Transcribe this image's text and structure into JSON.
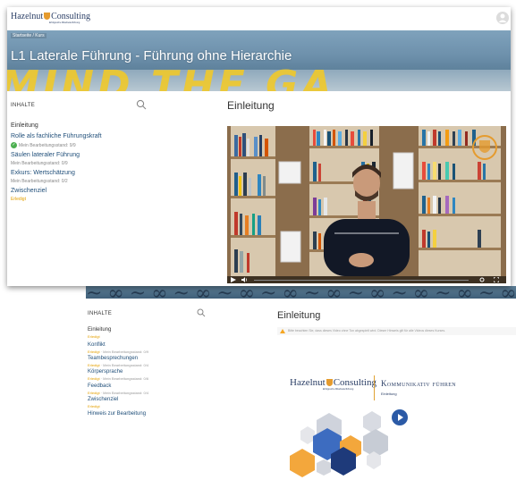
{
  "front": {
    "logo": {
      "brand_left": "Hazelnut",
      "brand_right": "Consulting",
      "tagline": "Erfolgreiche Mitarbeiterführung"
    },
    "breadcrumb": "Startseite / Kurs",
    "course_title": "L1 Laterale Führung - Führung ohne Hierarchie",
    "banner_text": "MIND THE GA",
    "sidebar": {
      "header": "INHALTE",
      "items": [
        {
          "label": "Einleitung",
          "sub": ""
        },
        {
          "label": "Rolle als fachliche Führungskraft",
          "sub": "Mein Bearbeitungsstand: 9/9",
          "done": true
        },
        {
          "label": "Säulen lateraler Führung",
          "sub": "Mein Bearbeitungsstand: 0/9"
        },
        {
          "label": "Exkurs: Wertschätzung",
          "sub": "Mein Bearbeitungsstand: 0/2"
        },
        {
          "label": "Zwischenziel",
          "sub": "Erledigt"
        }
      ]
    },
    "main_title": "Einleitung",
    "video": {
      "player": "video-player"
    }
  },
  "back": {
    "sidebar": {
      "header": "INHALTE",
      "items": [
        {
          "label": "Einleitung",
          "sub_status": "Erledigt",
          "sub": ""
        },
        {
          "label": "Konflikt",
          "sub_status": "Erledigt",
          "sub": "Mein Bearbeitungsstand: 0/9"
        },
        {
          "label": "Teambesprechungen",
          "sub_status": "Erledigt",
          "sub": "Mein Bearbeitungsstand: 0/4"
        },
        {
          "label": "Körpersprache",
          "sub_status": "Erledigt",
          "sub": "Mein Bearbeitungsstand: 0/6"
        },
        {
          "label": "Feedback",
          "sub_status": "Erledigt",
          "sub": "Mein Bearbeitungsstand: 0/4"
        },
        {
          "label": "Zwischenziel",
          "sub_status": "Erledigt",
          "sub": ""
        },
        {
          "label": "Hinweis zur Bearbeitung",
          "sub_status": "",
          "sub": ""
        }
      ]
    },
    "main_title": "Einleitung",
    "warning": "Bitte beachten Sie, dass dieses Video ohne Ton abgespielt wird. Dieser Hinweis gilt für alle Videos dieses Kurses.",
    "slide": {
      "logo_left": "Hazelnut",
      "logo_right": "Consulting",
      "logo_sub": "Erfolgreiche Mitarbeiterführung",
      "heading": "Kommunikativ führen",
      "subheading": "Einleitung"
    }
  },
  "colors": {
    "brand_navy": "#2b3f66",
    "accent_orange": "#e59b2e",
    "link_blue": "#1f4e79",
    "done_green": "#4caf50",
    "banner_yellow": "#f0c92b"
  }
}
